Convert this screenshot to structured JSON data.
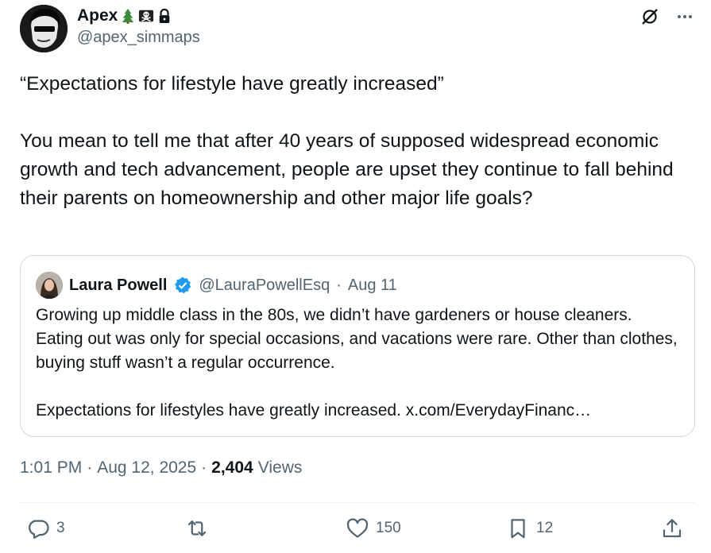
{
  "author": {
    "display_name": "Apex",
    "handle": "@apex_simmaps"
  },
  "tweet": {
    "text": "“Expectations for lifestyle have greatly increased”\n\nYou mean to tell me that after 40 years of supposed widespread economic growth and tech advancement, people are upset they continue to fall behind their parents on homeownership and other major life goals?"
  },
  "quote": {
    "name": "Laura Powell",
    "handle": "@LauraPowellEsq",
    "separator": "·",
    "date": "Aug 11",
    "text": "Growing up middle class in the 80s, we didn’t have gardeners or house cleaners. Eating out was only for special occasions, and vacations were rare. Other than clothes, buying stuff wasn’t a regular occurrence.\n\nExpectations for lifestyles have greatly increased. x.com/EverydayFinanc…"
  },
  "meta": {
    "time": "1:01 PM",
    "sep1": "·",
    "date": "Aug 12, 2025",
    "sep2": "·",
    "views_count": "2,404",
    "views_label": "Views"
  },
  "actions": {
    "replies": "3",
    "reposts": "",
    "likes": "150",
    "bookmarks": "12"
  },
  "icons": [
    "pine-tree-icon",
    "skull-crossbones-flag-icon",
    "lock-icon",
    "grok-icon",
    "more-icon",
    "verified-icon",
    "reply-icon",
    "repost-icon",
    "like-icon",
    "bookmark-icon",
    "share-icon"
  ],
  "colors": {
    "text": "#0f1419",
    "secondary": "#536471",
    "verified": "#1d9bf0",
    "border": "#cfd9de"
  }
}
